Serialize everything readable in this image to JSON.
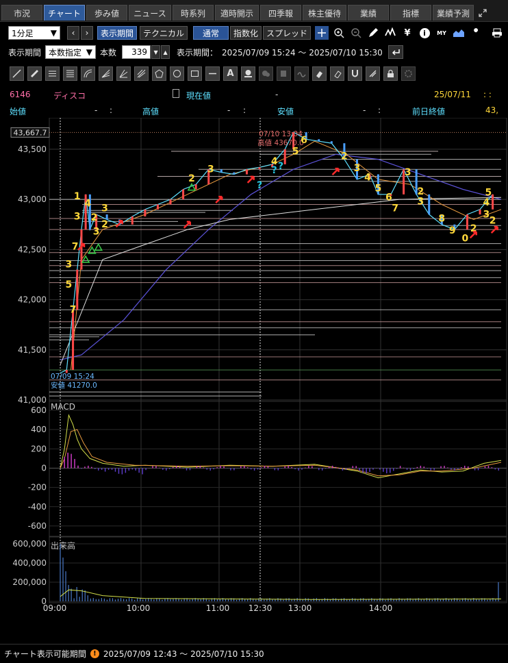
{
  "tabs": [
    "市況",
    "チャート",
    "歩み値",
    "ニュース",
    "時系列",
    "適時開示",
    "四季報",
    "株主優待",
    "業績",
    "指標",
    "業績予測"
  ],
  "active_tab": 1,
  "toolbar": {
    "interval": "1分足",
    "display_period_btn": "表示期間",
    "technical_btn": "テクニカル",
    "normal_btn": "通常",
    "index_btn": "指数化",
    "spread_btn": "スプレッド",
    "yen_icon": "¥",
    "info_icon": "i",
    "my_icon": "MY"
  },
  "period": {
    "label": "表示期間",
    "mode": "本数指定",
    "count_label": "本数",
    "count": "339",
    "range_label": "表示期間：",
    "range": "2025/07/09 15:24 ～ 2025/07/10 15:30"
  },
  "stock": {
    "code": "6146",
    "name": "ディスコ",
    "current_label": "現在値",
    "current_value": "-",
    "date": "25/07/11",
    "time": ":  :",
    "open_label": "始値",
    "open_value": "-",
    "open_time": ":",
    "high_label": "高値",
    "high_value": "-",
    "high_time": ":",
    "low_label": "安値",
    "low_value": "-",
    "low_time": ":",
    "prev_close_label": "前日終値",
    "prev_close_value": "43,"
  },
  "chart_data": {
    "type": "line",
    "price_axis": {
      "ticks": [
        "43,500",
        "43,000",
        "42,500",
        "42,000",
        "41,500",
        "41,000"
      ],
      "values": [
        43500,
        43000,
        42500,
        42000,
        41500,
        41000
      ],
      "ylim": [
        41000,
        43800
      ]
    },
    "last_price_label": "43,667.7",
    "high_annotation": {
      "time": "07/10 13:04",
      "label": "高値 43670.0"
    },
    "low_annotation": {
      "time": "07/09 15:24",
      "label": "安値 41270.0"
    },
    "x_ticks": [
      "09:00",
      "10:00",
      "11:00",
      "12:30",
      "13:00",
      "14:00"
    ],
    "price_series": [
      {
        "t": 0,
        "v": 41270
      },
      {
        "t": 3,
        "v": 41300
      },
      {
        "t": 6,
        "v": 41900
      },
      {
        "t": 8,
        "v": 42300
      },
      {
        "t": 10,
        "v": 42700
      },
      {
        "t": 12,
        "v": 43050
      },
      {
        "t": 14,
        "v": 42700
      },
      {
        "t": 17,
        "v": 42850
      },
      {
        "t": 22,
        "v": 42800
      },
      {
        "t": 28,
        "v": 42750
      },
      {
        "t": 34,
        "v": 42830
      },
      {
        "t": 40,
        "v": 42900
      },
      {
        "t": 46,
        "v": 42950
      },
      {
        "t": 52,
        "v": 43000
      },
      {
        "t": 58,
        "v": 43100
      },
      {
        "t": 64,
        "v": 43150
      },
      {
        "t": 70,
        "v": 43300
      },
      {
        "t": 76,
        "v": 43270
      },
      {
        "t": 82,
        "v": 43250
      },
      {
        "t": 88,
        "v": 43300
      },
      {
        "t": 94,
        "v": 43320
      },
      {
        "t": 100,
        "v": 43350
      },
      {
        "t": 106,
        "v": 43500
      },
      {
        "t": 110,
        "v": 43670
      },
      {
        "t": 116,
        "v": 43600
      },
      {
        "t": 122,
        "v": 43580
      },
      {
        "t": 128,
        "v": 43560
      },
      {
        "t": 134,
        "v": 43400
      },
      {
        "t": 140,
        "v": 43200
      },
      {
        "t": 146,
        "v": 43250
      },
      {
        "t": 150,
        "v": 43050
      },
      {
        "t": 156,
        "v": 43050
      },
      {
        "t": 162,
        "v": 43300
      },
      {
        "t": 168,
        "v": 43050
      },
      {
        "t": 174,
        "v": 42850
      },
      {
        "t": 180,
        "v": 42750
      },
      {
        "t": 186,
        "v": 42700
      },
      {
        "t": 192,
        "v": 42850
      },
      {
        "t": 198,
        "v": 42900
      },
      {
        "t": 204,
        "v": 43050
      }
    ],
    "td_labels": [
      {
        "t": 8,
        "v": 43000,
        "text": "1"
      },
      {
        "t": 7,
        "v": 42500,
        "text": "7"
      },
      {
        "t": 4,
        "v": 42320,
        "text": "3"
      },
      {
        "t": 4,
        "v": 42120,
        "text": "5"
      },
      {
        "t": 6,
        "v": 41870,
        "text": "7"
      },
      {
        "t": 8,
        "v": 42800,
        "text": "3"
      },
      {
        "t": 13,
        "v": 42930,
        "text": "4"
      },
      {
        "t": 16,
        "v": 42790,
        "text": "2"
      },
      {
        "t": 17,
        "v": 42650,
        "text": "3"
      },
      {
        "t": 21,
        "v": 42880,
        "text": "3"
      },
      {
        "t": 21,
        "v": 42720,
        "text": "2"
      },
      {
        "t": 62,
        "v": 43180,
        "text": "2"
      },
      {
        "t": 71,
        "v": 43270,
        "text": "3"
      },
      {
        "t": 101,
        "v": 43350,
        "text": "4"
      },
      {
        "t": 111,
        "v": 43450,
        "text": "5"
      },
      {
        "t": 115,
        "v": 43560,
        "text": "6"
      },
      {
        "t": 134,
        "v": 43400,
        "text": "2"
      },
      {
        "t": 140,
        "v": 43280,
        "text": "3"
      },
      {
        "t": 145,
        "v": 43190,
        "text": "4"
      },
      {
        "t": 150,
        "v": 43080,
        "text": "5"
      },
      {
        "t": 155,
        "v": 42990,
        "text": "6"
      },
      {
        "t": 158,
        "v": 42880,
        "text": "7"
      },
      {
        "t": 164,
        "v": 43240,
        "text": "3"
      },
      {
        "t": 170,
        "v": 43050,
        "text": "2"
      },
      {
        "t": 170,
        "v": 42950,
        "text": "3"
      },
      {
        "t": 180,
        "v": 42780,
        "text": "8"
      },
      {
        "t": 185,
        "v": 42660,
        "text": "9"
      },
      {
        "t": 191,
        "v": 42580,
        "text": "0"
      },
      {
        "t": 195,
        "v": 42680,
        "text": "2"
      },
      {
        "t": 202,
        "v": 43040,
        "text": "5"
      },
      {
        "t": 201,
        "v": 42940,
        "text": "4"
      },
      {
        "t": 201,
        "v": 42820,
        "text": "3"
      },
      {
        "t": 204,
        "v": 42760,
        "text": "2"
      }
    ],
    "question_marks": [
      {
        "t": 94,
        "v": 43110
      },
      {
        "t": 101,
        "v": 43260
      },
      {
        "t": 104,
        "v": 43300
      }
    ],
    "macd": {
      "label": "MACD",
      "ticks": [
        "600",
        "400",
        "200",
        "0",
        "-200",
        "-400",
        "-600"
      ],
      "values": [
        600,
        400,
        200,
        0,
        -200,
        -400,
        -600
      ],
      "ylim": [
        -700,
        650
      ]
    },
    "volume": {
      "label": "出来高",
      "ticks": [
        "600,000",
        "400,000",
        "200,000",
        "0"
      ],
      "values": [
        600000,
        400000,
        200000,
        0
      ],
      "ylim": [
        0,
        650000
      ]
    },
    "nav_ticks": [
      "13:00",
      "14:00",
      "09:00",
      "10:00",
      "11:00",
      "12:30",
      "13:00",
      "14:00"
    ]
  },
  "bottom": {
    "label": "チャート表示可能期間",
    "range": "2025/07/09 12:43 ～ 2025/07/10 15:30"
  },
  "colors": {
    "accent": "#2e5a9a",
    "up": "#ff3b3b",
    "down": "#3b8bff",
    "td_label": "#ffd83a",
    "question": "#27c6e0"
  }
}
